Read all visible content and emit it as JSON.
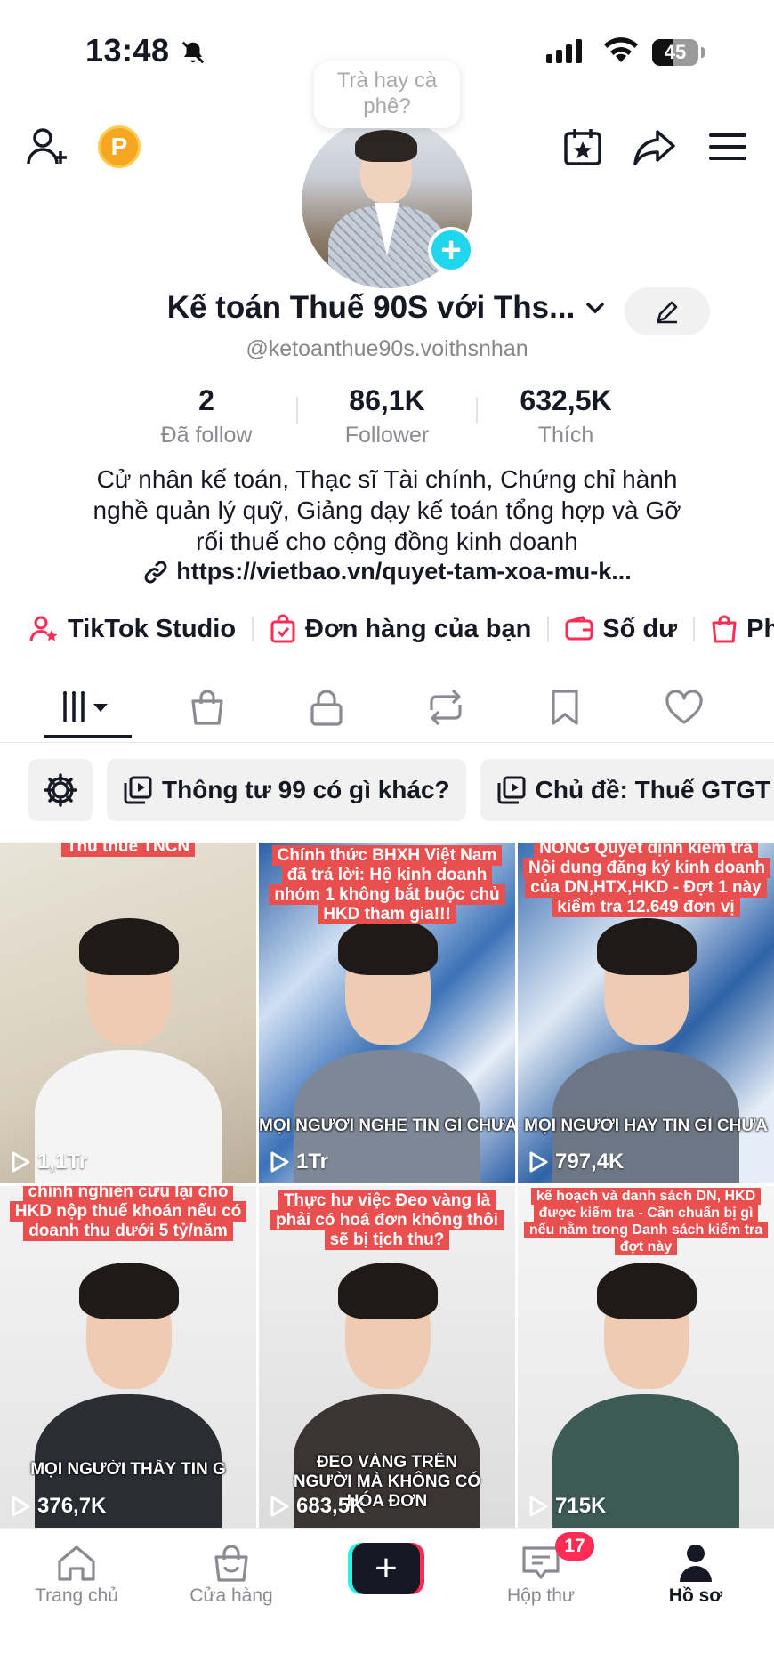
{
  "status_bar": {
    "time": "13:48",
    "battery": "45"
  },
  "header": {
    "coin_letter": "P",
    "tooltip": "Trà hay cà phê?"
  },
  "profile": {
    "name": "Kế toán Thuế 90S với Ths...",
    "handle": "@ketoanthue90s.voithsnhan",
    "stats": [
      {
        "value": "2",
        "label": "Đã follow"
      },
      {
        "value": "86,1K",
        "label": "Follower"
      },
      {
        "value": "632,5K",
        "label": "Thích"
      }
    ],
    "bio_lines": [
      "Cử nhân kế toán, Thạc sĩ Tài chính, Chứng chỉ hành",
      "nghề quản lý quỹ, Giảng dạy kế toán tổng hợp và Gỡ",
      "rối thuế cho cộng đồng kinh doanh"
    ],
    "link": "https://vietbao.vn/quyet-tam-xoa-mu-k..."
  },
  "shortcuts": [
    {
      "label": "TikTok Studio",
      "icon": "person-star-icon"
    },
    {
      "label": "Đơn hàng của bạn",
      "icon": "order-bag-icon"
    },
    {
      "label": "Số dư",
      "icon": "wallet-icon"
    },
    {
      "label": "Phần",
      "icon": "shopping-bag-icon"
    }
  ],
  "tabs": [
    "videos-grid-icon",
    "shop-bag-icon",
    "lock-icon",
    "repost-icon",
    "bookmark-icon",
    "heart-icon"
  ],
  "playlists": [
    {
      "label": "Thông tư 99 có gì khác?"
    },
    {
      "label": "Chủ đề: Thuế GTGT"
    }
  ],
  "videos": [
    {
      "caption": "Thủ thuế TNCN",
      "subcaption": "",
      "views": "1,1Tr"
    },
    {
      "caption": "Chính thức BHXH Việt Nam đã trả lời: Hộ kinh doanh nhóm 1 không bắt buộc chủ HKD tham gia!!!",
      "subcaption": "MỌI NGƯỜI NGHE TIN GÌ CHƯA?",
      "views": "1Tr"
    },
    {
      "caption": "NÓNG Quyết định kiểm tra Nội dung đăng ký kinh doanh của DN,HTX,HKD - Đợt 1 này kiểm tra 12.649 đơn vị",
      "subcaption": "MỌI NGƯỜI HAY TIN GÌ CHƯA",
      "views": "797,4K"
    },
    {
      "caption": "chính nghiên cứu lại cho HKD nộp thuế khoán nếu có doanh thu dưới 5 tỷ/năm",
      "subcaption": "MỌI NGƯỜI THẤY TIN G",
      "views": "376,7K"
    },
    {
      "caption": "Thực hư việc Đeo vàng là phải có hoá đơn không thôi sẽ bị tịch thu?",
      "subcaption": "ĐEO VÀNG TRÊN NGƯỜI MÀ KHÔNG CÓ HÓA ĐƠN",
      "views": "683,5K"
    },
    {
      "caption": "kế hoạch và danh sách DN, HKD được kiểm tra - Cần chuẩn bị gì nếu nằm trong Danh sách kiểm tra đợt này",
      "subcaption": "",
      "views": "715K"
    }
  ],
  "bottom_nav": {
    "home": "Trang chủ",
    "shop": "Cửa hàng",
    "inbox": "Hộp thư",
    "inbox_badge": "17",
    "profile": "Hồ sơ"
  },
  "colors": {
    "accent": "#fe2c55",
    "teal": "#20d5ec",
    "text": "#161823",
    "muted": "#86878b"
  }
}
